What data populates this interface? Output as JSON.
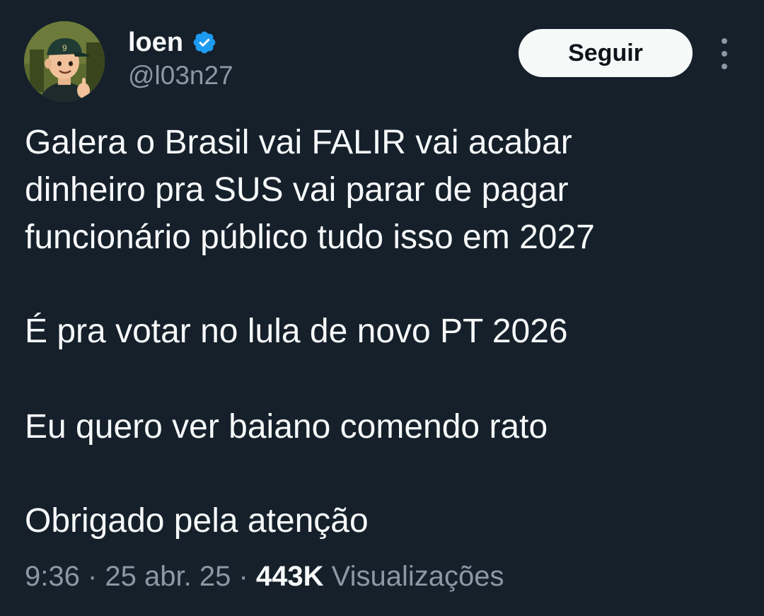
{
  "author": {
    "display_name": "loen",
    "handle": "@l03n27",
    "verified_icon": "verified-badge-icon",
    "verified_color": "#1d9bf0",
    "avatar_icon": "cartoon-avatar"
  },
  "actions": {
    "follow_label": "Seguir",
    "more_icon": "more-options-icon"
  },
  "tweet": {
    "paragraphs": [
      [
        "Galera o Brasil vai FALIR vai acabar",
        "dinheiro pra SUS vai parar de pagar",
        "funcionário público tudo isso em 2027"
      ],
      [
        "É pra votar no lula de novo PT 2026"
      ],
      [
        "Eu quero ver baiano comendo rato"
      ],
      [
        "Obrigado pela atenção"
      ]
    ]
  },
  "meta": {
    "time": "9:36",
    "separator": " · ",
    "date": "25 abr. 25",
    "views_count": "443K",
    "views_label": "Visualizações"
  },
  "colors": {
    "background": "#15202b",
    "primary_text": "#f7f9f9",
    "secondary_text": "#8b98a5",
    "button_bg": "#f7f9f9",
    "button_text": "#0f1419"
  }
}
